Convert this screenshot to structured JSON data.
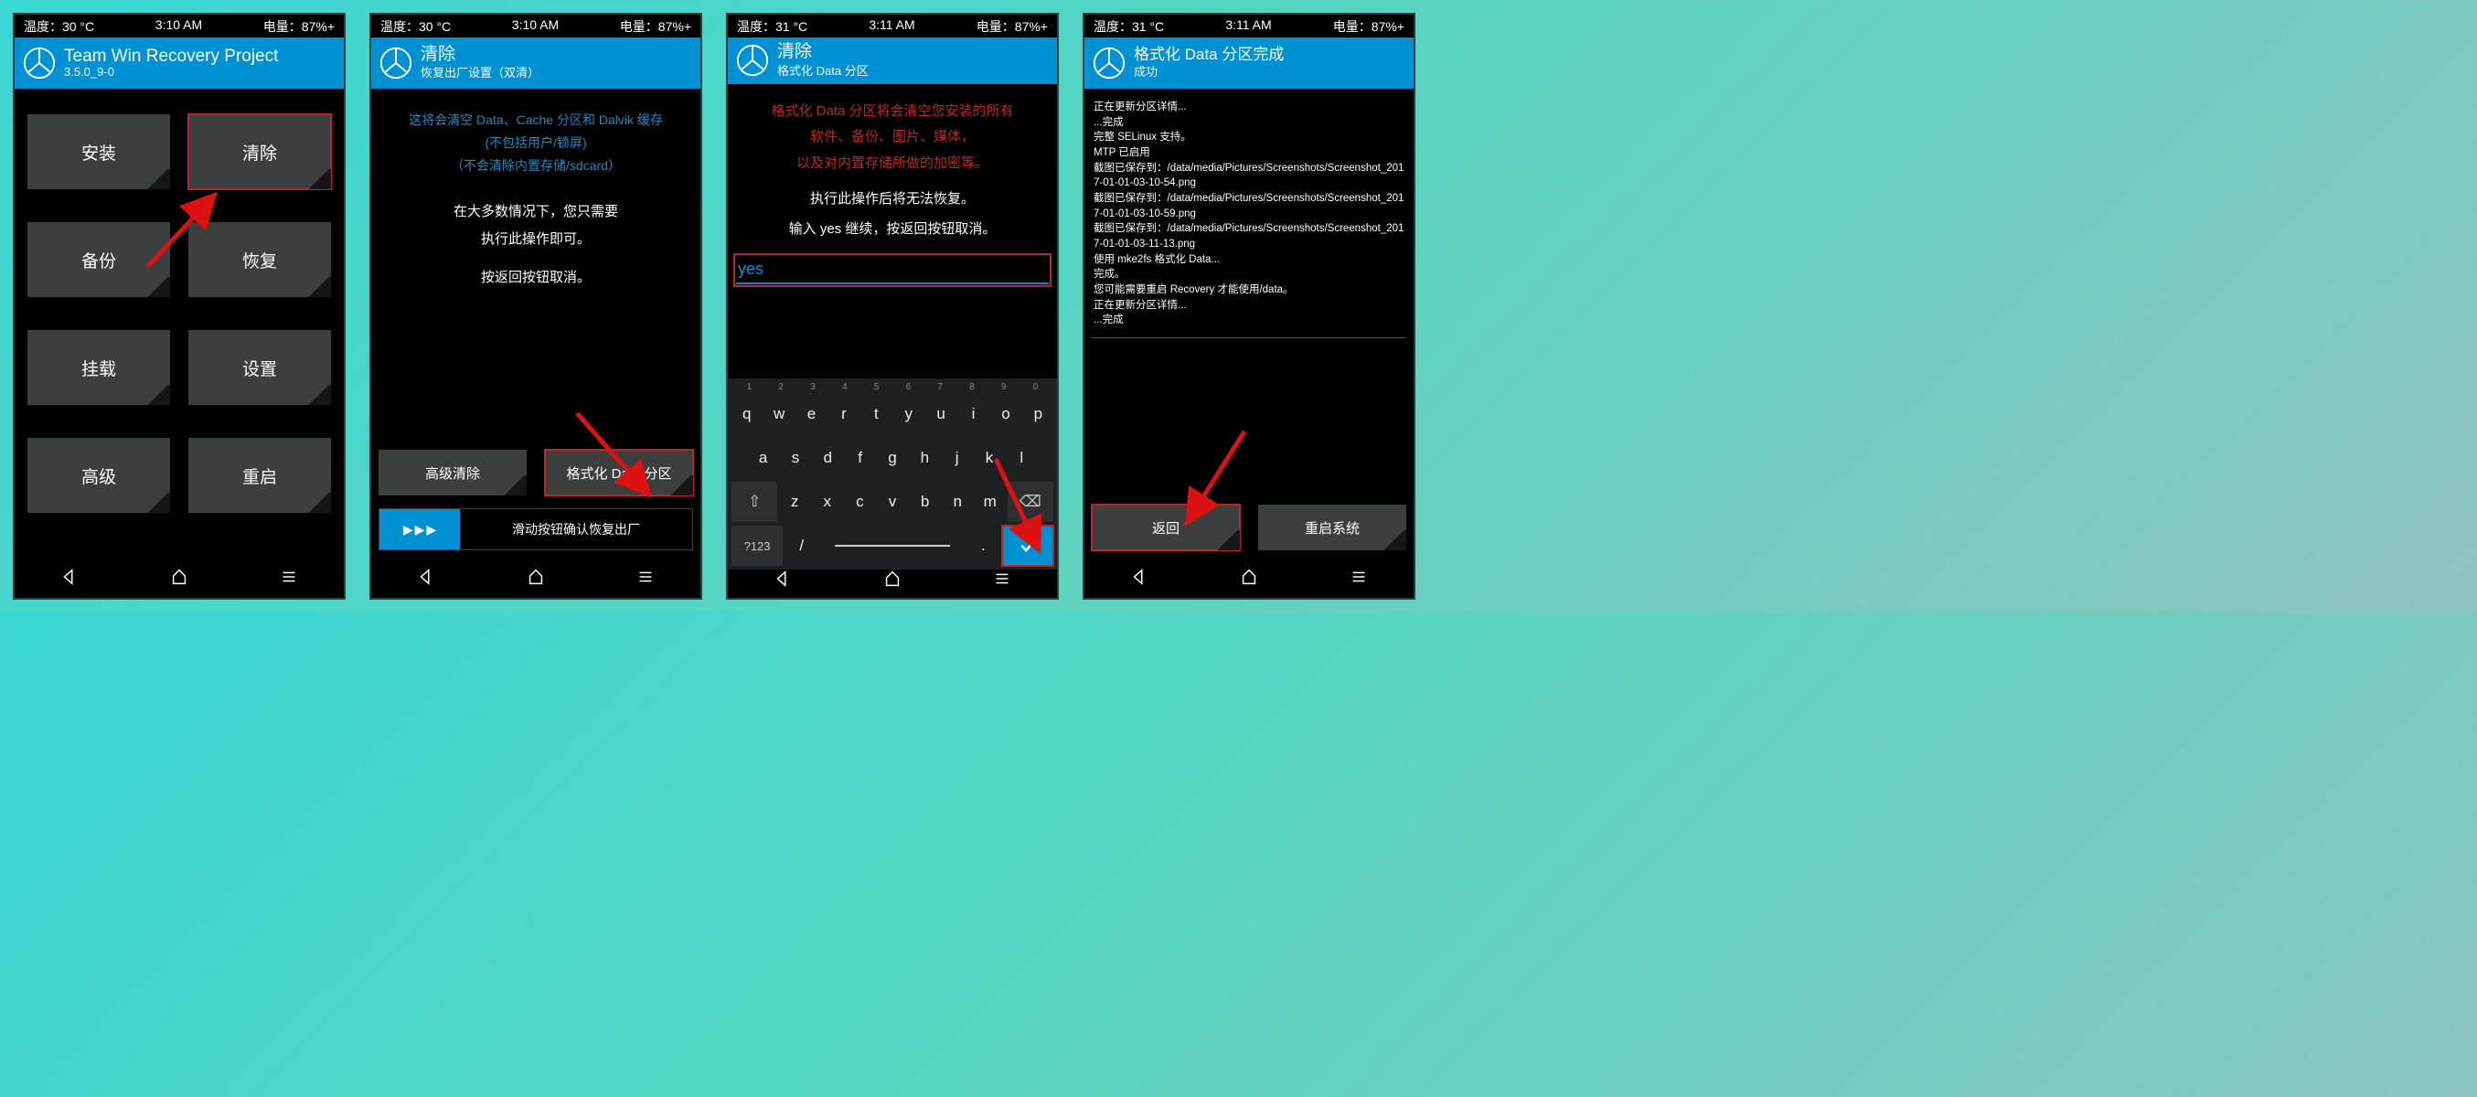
{
  "screens": [
    {
      "status": {
        "temp": "温度：30 °C",
        "time": "3:10 AM",
        "batt": "电量：87%+"
      },
      "title": "Team Win Recovery Project",
      "subtitle": "3.5.0_9-0",
      "tiles": [
        "安装",
        "清除",
        "备份",
        "恢复",
        "挂载",
        "设置",
        "高级",
        "重启"
      ]
    },
    {
      "status": {
        "temp": "温度：30 °C",
        "time": "3:10 AM",
        "batt": "电量：87%+"
      },
      "title": "清除",
      "subtitle": "恢复出厂设置（双清）",
      "info_blue": [
        "这将会清空 Data、Cache 分区和 Dalvik 缓存",
        "(不包括用户/锁屏)",
        "（不会清除内置存储/sdcard）"
      ],
      "info_white": [
        "在大多数情况下，您只需要",
        "执行此操作即可。",
        "",
        "按返回按钮取消。"
      ],
      "btn_left": "高级清除",
      "btn_right": "格式化 Data 分区",
      "slider": "滑动按钮确认恢复出厂"
    },
    {
      "status": {
        "temp": "温度：31 °C",
        "time": "3:11 AM",
        "batt": "电量：87%+"
      },
      "title": "清除",
      "subtitle": "格式化 Data 分区",
      "warn": [
        "格式化 Data 分区将会清空您安装的所有",
        "软件、备份、图片、媒体，",
        "以及对内置存储所做的加密等。"
      ],
      "info_white": [
        "执行此操作后将无法恢复。",
        "",
        "输入 yes 继续，按返回按钮取消。"
      ],
      "input_value": "yes",
      "kb_hints": [
        "1",
        "2",
        "3",
        "4",
        "5",
        "6",
        "7",
        "8",
        "9",
        "0"
      ],
      "kb_r1": [
        "q",
        "w",
        "e",
        "r",
        "t",
        "y",
        "u",
        "i",
        "o",
        "p"
      ],
      "kb_r2": [
        "a",
        "s",
        "d",
        "f",
        "g",
        "h",
        "j",
        "k",
        "l"
      ],
      "kb_r3": [
        "z",
        "x",
        "c",
        "v",
        "b",
        "n",
        "m"
      ],
      "kb_shift": "⇧",
      "kb_del": "⌫",
      "kb_meta": "?123",
      "kb_slash": "/",
      "kb_dot": ".",
      "kb_ok": "✓"
    },
    {
      "status": {
        "temp": "温度：31 °C",
        "time": "3:11 AM",
        "batt": "电量：87%+"
      },
      "title": "格式化 Data 分区完成",
      "subtitle": "成功",
      "log": [
        "正在更新分区详情...",
        "...完成",
        "完整 SELinux 支持。",
        "MTP 已启用",
        "截图已保存到：/data/media/Pictures/Screenshots/Screenshot_2017-01-01-03-10-54.png",
        "截图已保存到：/data/media/Pictures/Screenshots/Screenshot_2017-01-01-03-10-59.png",
        "截图已保存到：/data/media/Pictures/Screenshots/Screenshot_2017-01-01-03-11-13.png",
        "使用 mke2fs 格式化 Data...",
        "完成。",
        "您可能需要重启 Recovery 才能使用/data。",
        "正在更新分区详情...",
        "...完成"
      ],
      "btn_left": "返回",
      "btn_right": "重启系统"
    }
  ]
}
